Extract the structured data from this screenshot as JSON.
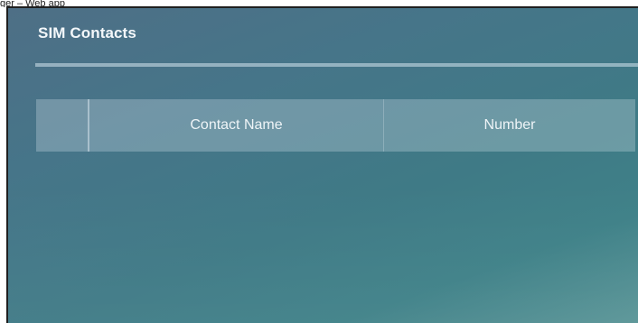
{
  "app": {
    "caption": "ger – Web app"
  },
  "panel": {
    "title": "SIM Contacts"
  },
  "table": {
    "columns": [
      {
        "key": "select",
        "label": ""
      },
      {
        "key": "name",
        "label": "Contact Name"
      },
      {
        "key": "number",
        "label": "Number"
      }
    ],
    "rows": []
  },
  "colors": {
    "panel_gradient_start": "#4e6f86",
    "panel_gradient_end": "#5a9597",
    "header_text": "#eef4f7",
    "title_text": "#f3f7fa"
  }
}
